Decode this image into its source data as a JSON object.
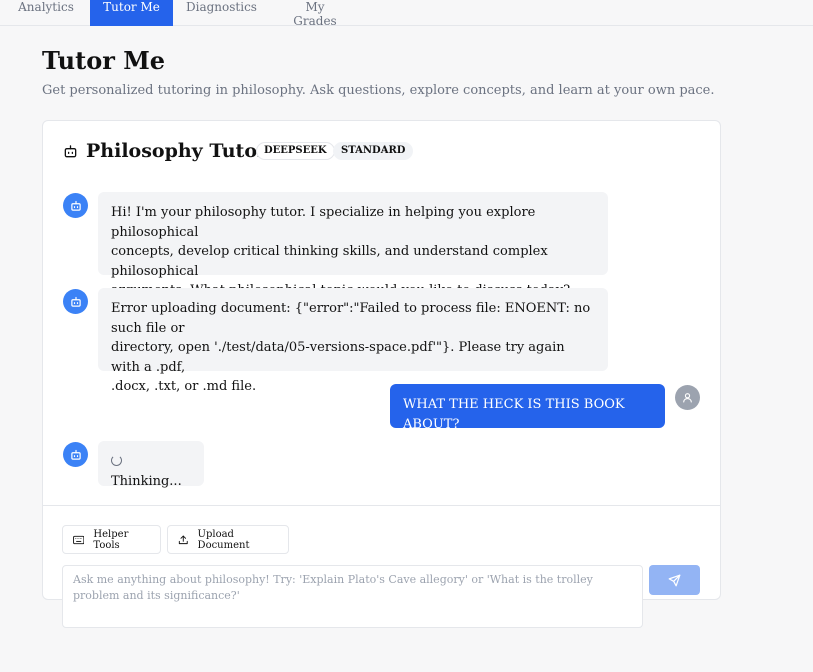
{
  "nav": {
    "tabs": [
      {
        "label": "Analytics"
      },
      {
        "label": "Tutor Me"
      },
      {
        "label": "Diagnostics"
      },
      {
        "label": "My Grades"
      }
    ]
  },
  "page": {
    "title": "Tutor Me",
    "subtitle": "Get personalized tutoring in philosophy. Ask questions, explore concepts, and learn at your own pace."
  },
  "tutor": {
    "title": "Philosophy Tutor",
    "badges": [
      "DEEPSEEK",
      "STANDARD"
    ]
  },
  "messages": [
    {
      "role": "assistant",
      "lines": [
        "Hi! I'm your philosophy tutor. I specialize in helping you explore philosophical",
        "concepts, develop critical thinking skills, and understand complex philosophical",
        "arguments. What philosophical topic would you like to discuss today?"
      ]
    },
    {
      "role": "assistant",
      "lines": [
        "Error uploading document: {\"error\":\"Failed to process file: ENOENT: no such file or",
        "directory, open './test/data/05-versions-space.pdf'\"}. Please try again with a .pdf,",
        ".docx, .txt, or .md file."
      ]
    },
    {
      "role": "user",
      "text": "WHAT THE HECK IS THIS BOOK ABOUT?"
    },
    {
      "role": "assistant",
      "text": "Thinking..."
    }
  ],
  "tools": {
    "helper_label": "Helper Tools",
    "upload_label": "Upload Document"
  },
  "input": {
    "placeholder": "Ask me anything about philosophy! Try: 'Explain Plato's Cave allegory' or 'What is the trolley problem and its significance?'",
    "value": ""
  },
  "colors": {
    "accent": "#2563eb",
    "bot_avatar": "#3b82f6",
    "send_disabled": "#93b4f4"
  }
}
